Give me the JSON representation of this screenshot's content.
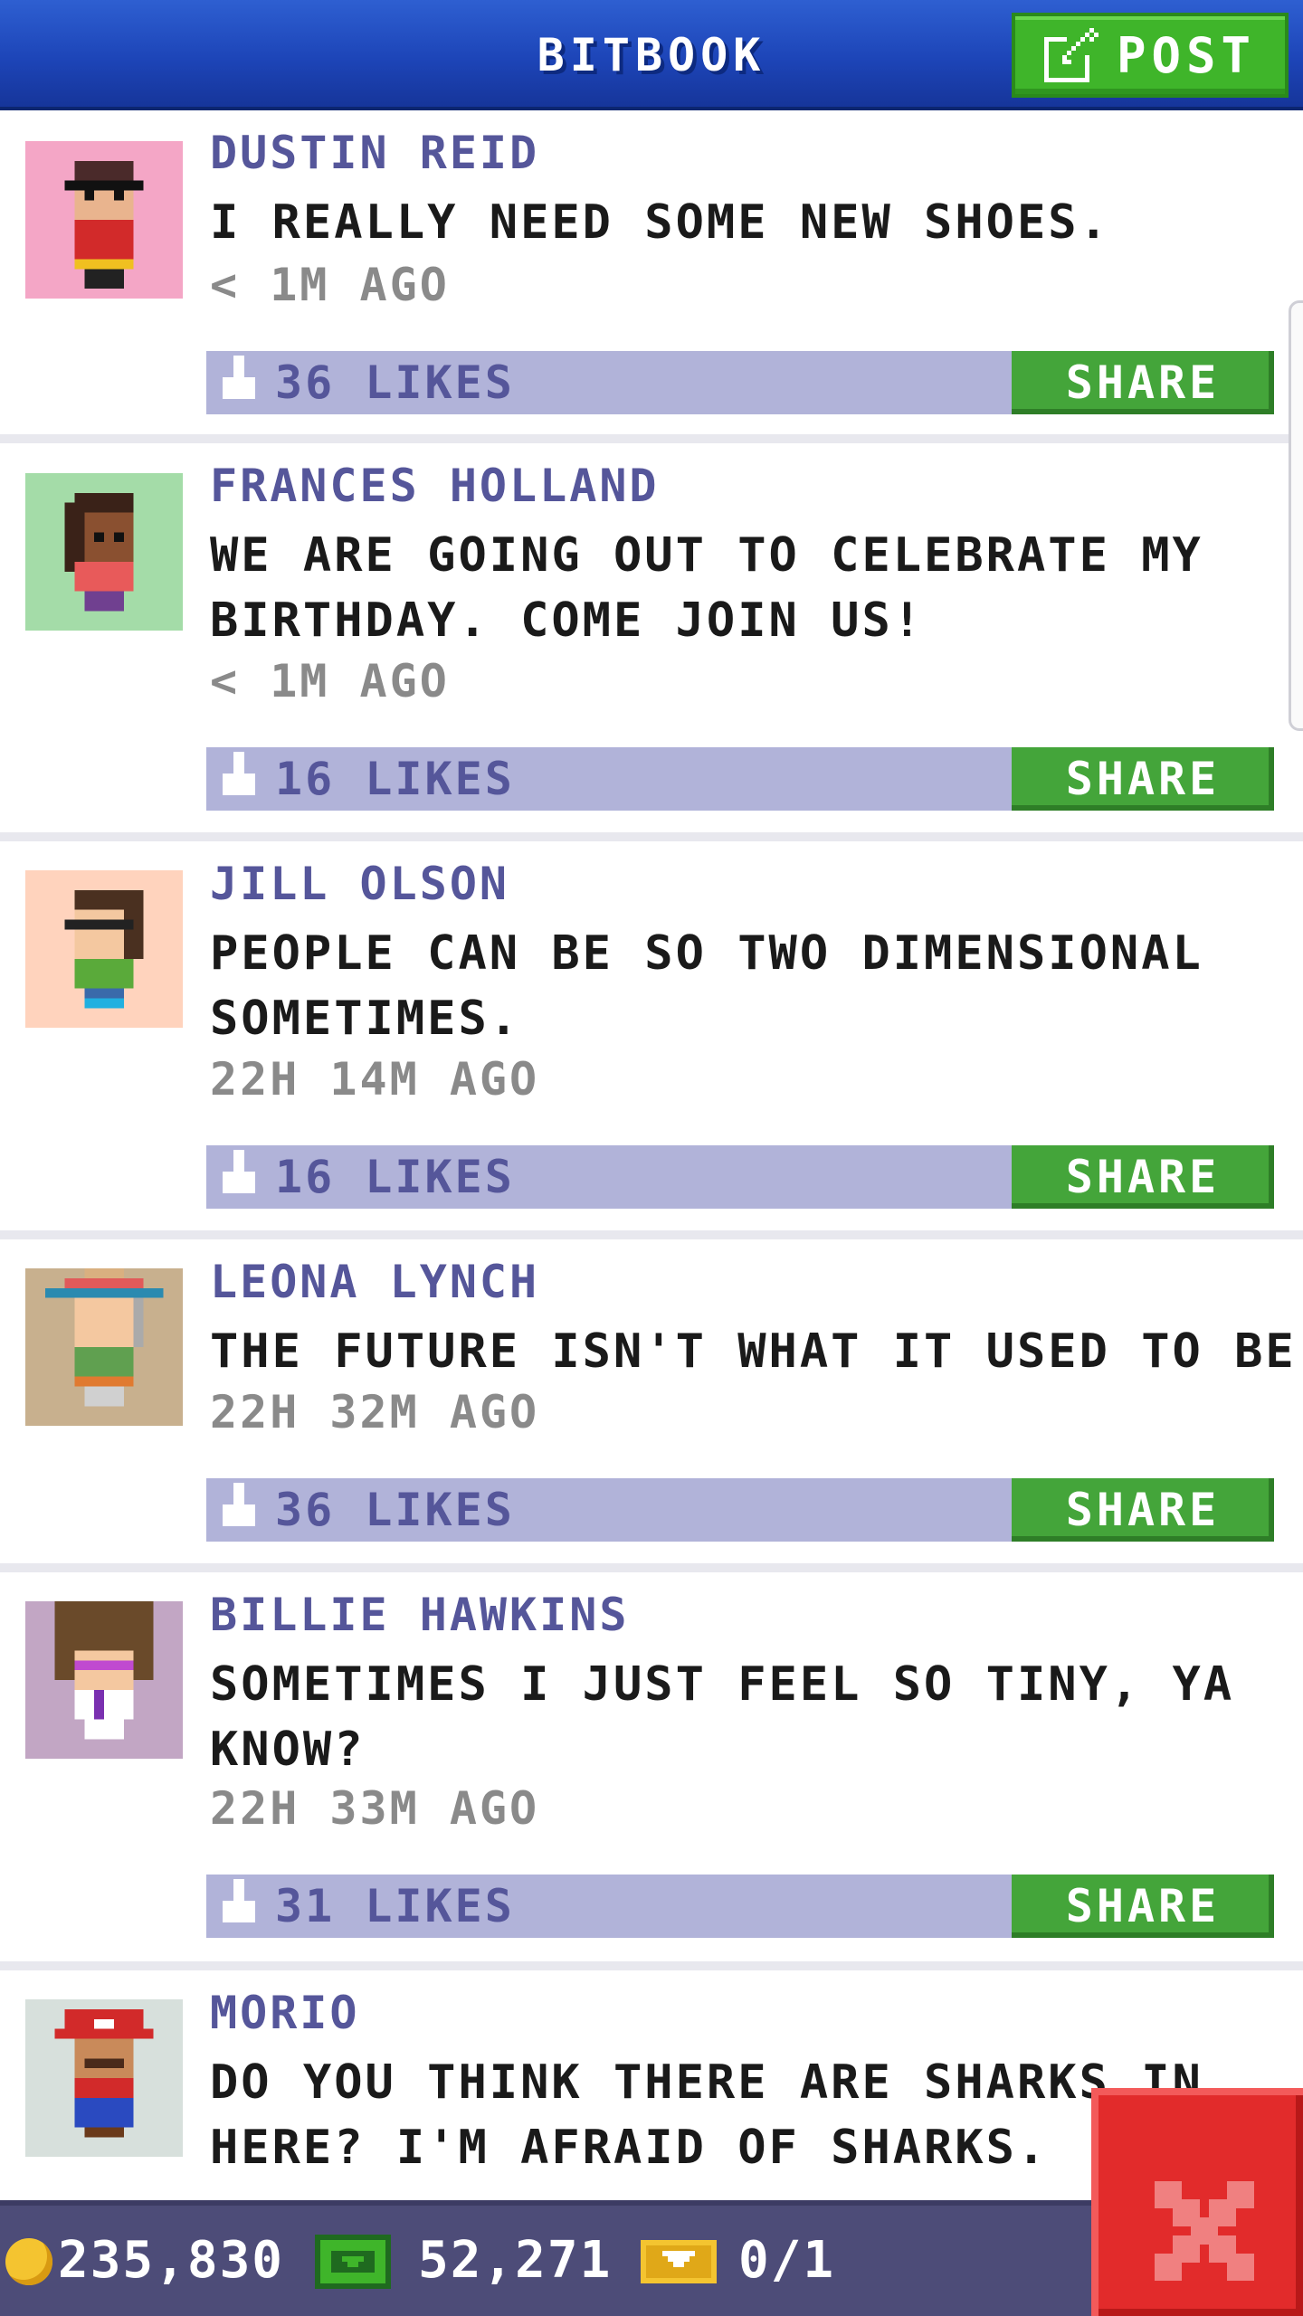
{
  "header": {
    "title": "BITBOOK",
    "post_label": "POST"
  },
  "posts": [
    {
      "name": "DUSTIN REID",
      "message": "I REALLY NEED SOME NEW SHOES.",
      "time": "< 1M AGO",
      "likes": "36 LIKES",
      "share": "SHARE",
      "avatar_bg": "#f4a6c6"
    },
    {
      "name": "FRANCES HOLLAND",
      "message": "WE ARE GOING OUT TO CELEBRATE MY BIRTHDAY. COME JOIN US!",
      "time": "< 1M AGO",
      "likes": "16 LIKES",
      "share": "SHARE",
      "avatar_bg": "#a4dca8"
    },
    {
      "name": "JILL OLSON",
      "message": "PEOPLE CAN BE SO TWO DIMENSIONAL SOMETIMES.",
      "time": "22H 14M AGO",
      "likes": "16 LIKES",
      "share": "SHARE",
      "avatar_bg": "#ffd3bd"
    },
    {
      "name": "LEONA LYNCH",
      "message": "THE FUTURE ISN'T WHAT IT USED TO BE...",
      "time": "22H 32M AGO",
      "likes": "36 LIKES",
      "share": "SHARE",
      "avatar_bg": "#c8b08e"
    },
    {
      "name": "BILLIE HAWKINS",
      "message": "SOMETIMES I JUST FEEL SO TINY, YA KNOW?",
      "time": "22H 33M AGO",
      "likes": "31 LIKES",
      "share": "SHARE",
      "avatar_bg": "#c2a6c4"
    },
    {
      "name": "MORIO",
      "message": "DO YOU THINK THERE ARE SHARKS IN HERE? I'M AFRAID OF SHARKS.",
      "time": "",
      "likes": "",
      "share": "",
      "avatar_bg": "#d7e0dc"
    }
  ],
  "status": {
    "coins": "235,830",
    "bux": "52,271",
    "tickets": "0/1"
  },
  "colors": {
    "header_blue": "#1d45b8",
    "post_green": "#3fb52a",
    "like_bar": "#b1b3d9",
    "name_purple": "#55569a",
    "close_red": "#e22b2b"
  }
}
